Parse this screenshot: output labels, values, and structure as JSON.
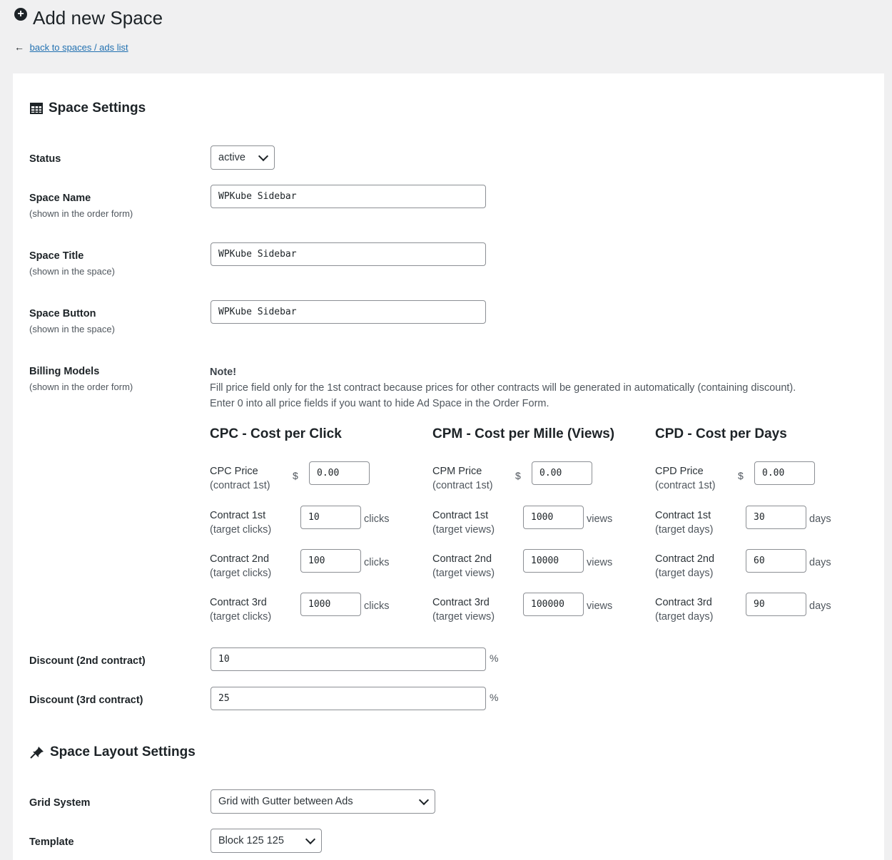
{
  "header": {
    "title": "Add new Space",
    "back_arrow": "←",
    "back_link": "back to spaces / ads list"
  },
  "space_settings": {
    "title": "Space Settings",
    "icon": "table-icon",
    "status": {
      "label": "Status",
      "value": "active"
    },
    "space_name": {
      "label": "Space Name",
      "sub": "(shown in the order form)",
      "value": "WPKube Sidebar"
    },
    "space_title": {
      "label": "Space Title",
      "sub": "(shown in the space)",
      "value": "WPKube Sidebar"
    },
    "space_button": {
      "label": "Space Button",
      "sub": "(shown in the space)",
      "value": "WPKube Sidebar"
    },
    "billing": {
      "label": "Billing Models",
      "sub": "(shown in the order form)",
      "note_title": "Note!",
      "note_line1": "Fill price field only for the 1st contract because prices for other contracts will be generated in automatically (containing discount).",
      "note_line2": "Enter 0 into all price fields if you want to hide Ad Space in the Order Form."
    },
    "models": [
      {
        "title": "CPC - Cost per Click",
        "price_label": "CPC Price",
        "price_sub": "(contract 1st)",
        "currency": "$",
        "price": "0.00",
        "unit": "clicks",
        "contracts": [
          {
            "label": "Contract 1st",
            "sub": "(target clicks)",
            "value": "10"
          },
          {
            "label": "Contract 2nd",
            "sub": "(target clicks)",
            "value": "100"
          },
          {
            "label": "Contract 3rd",
            "sub": "(target clicks)",
            "value": "1000"
          }
        ]
      },
      {
        "title": "CPM - Cost per Mille (Views)",
        "price_label": "CPM Price",
        "price_sub": "(contract 1st)",
        "currency": "$",
        "price": "0.00",
        "unit": "views",
        "contracts": [
          {
            "label": "Contract 1st",
            "sub": "(target views)",
            "value": "1000"
          },
          {
            "label": "Contract 2nd",
            "sub": "(target views)",
            "value": "10000"
          },
          {
            "label": "Contract 3rd",
            "sub": "(target views)",
            "value": "100000"
          }
        ]
      },
      {
        "title": "CPD - Cost per Days",
        "price_label": "CPD Price",
        "price_sub": "(contract 1st)",
        "currency": "$",
        "price": "0.00",
        "unit": "days",
        "contracts": [
          {
            "label": "Contract 1st",
            "sub": "(target days)",
            "value": "30"
          },
          {
            "label": "Contract 2nd",
            "sub": "(target days)",
            "value": "60"
          },
          {
            "label": "Contract 3rd",
            "sub": "(target days)",
            "value": "90"
          }
        ]
      }
    ],
    "discount_2nd": {
      "label": "Discount (2nd contract)",
      "value": "10",
      "unit": "%"
    },
    "discount_3rd": {
      "label": "Discount (3rd contract)",
      "value": "25",
      "unit": "%"
    }
  },
  "layout_settings": {
    "title": "Space Layout Settings",
    "icon": "pin-icon",
    "grid": {
      "label": "Grid System",
      "value": "Grid with Gutter between Ads"
    },
    "template": {
      "label": "Template",
      "value": "Block 125 125"
    }
  }
}
